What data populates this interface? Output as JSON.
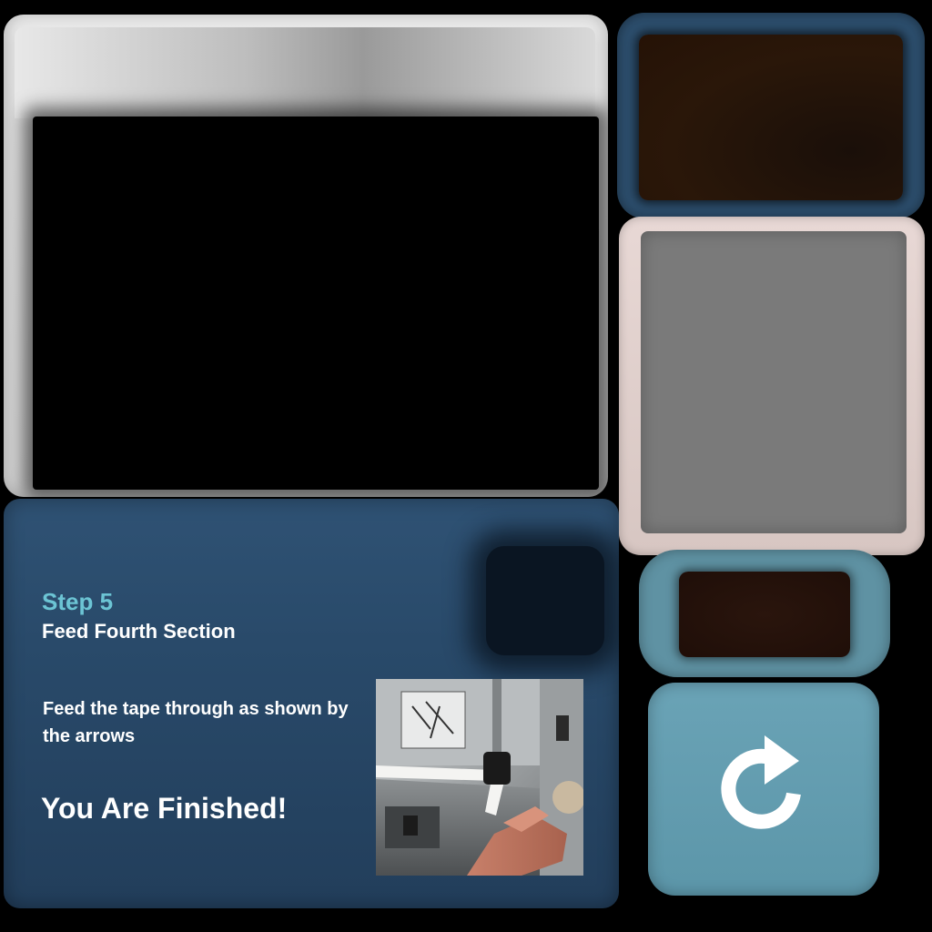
{
  "step": {
    "title": "Step 5",
    "subtitle": "Feed Fourth Section",
    "instruction": "Feed the tape through as shown by the arrows",
    "finished": "You Are Finished!"
  },
  "colors": {
    "panel_blue": "#294a6a",
    "step_accent": "#6cc4d4",
    "button_blue": "#6aa3b6",
    "text": "#ffffff"
  },
  "icons": {
    "restart": "restart-icon"
  }
}
